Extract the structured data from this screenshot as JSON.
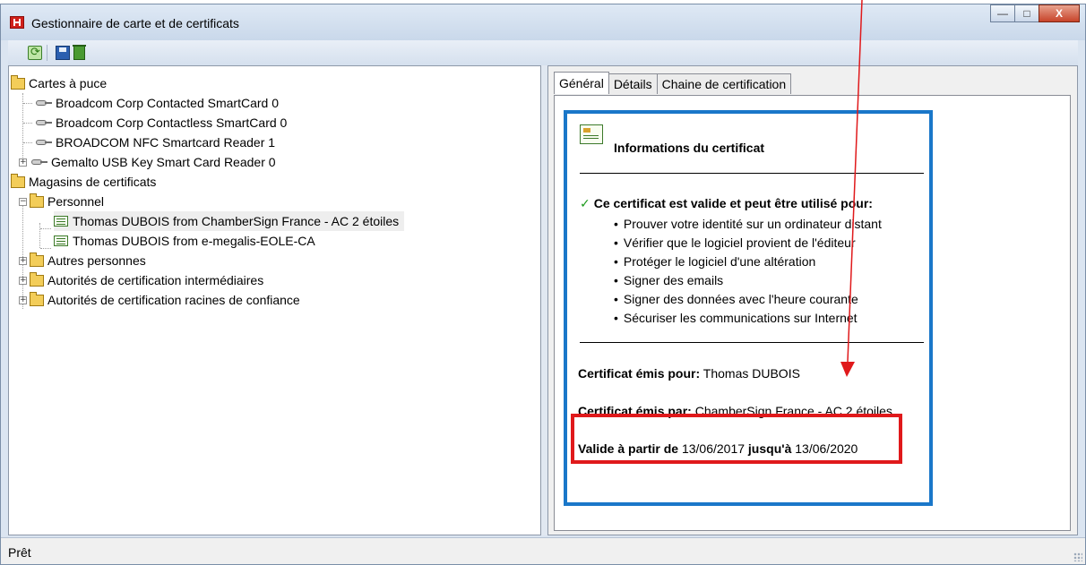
{
  "window": {
    "title": "Gestionnaire de carte et de certificats",
    "minimize_symbol": "—",
    "maximize_symbol": "□",
    "close_symbol": "X"
  },
  "tree": {
    "smartcards_label": "Cartes à puce",
    "readers": [
      "Broadcom Corp Contacted SmartCard 0",
      "Broadcom Corp Contactless SmartCard 0",
      "BROADCOM NFC Smartcard Reader 1",
      "Gemalto USB Key Smart Card Reader 0"
    ],
    "stores_label": "Magasins de certificats",
    "personal_label": "Personnel",
    "certificates": [
      "Thomas DUBOIS from ChamberSign France - AC 2 étoiles",
      "Thomas DUBOIS from e-megalis-EOLE-CA"
    ],
    "other_people_label": "Autres personnes",
    "intermediate_label": "Autorités de certification intermédiaires",
    "root_label": "Autorités de certification racines de confiance",
    "expand_symbol": "+",
    "collapse_symbol": "−"
  },
  "tabs": [
    "Général",
    "Détails",
    "Chaine de certification"
  ],
  "certificate": {
    "info_title": "Informations du certificat",
    "check_mark": "✓",
    "valid_heading": "Ce certificat est valide et peut être utilisé pour:",
    "purposes": [
      "Prouver votre identité sur un ordinateur distant",
      "Vérifier que le logiciel provient de l'éditeur",
      "Protéger le logiciel d'une altération",
      "Signer des emails",
      "Signer des données avec l'heure courante",
      "Sécuriser les communications sur Internet"
    ],
    "issued_to_label": "Certificat émis pour:",
    "issued_to_value": "Thomas DUBOIS",
    "issued_by_label": "Certificat émis par:",
    "issued_by_value": "ChamberSign France - AC 2 étoiles",
    "valid_from_label": "Valide à partir de",
    "valid_from_value": "13/06/2017",
    "valid_to_label": "jusqu'à",
    "valid_to_value": "13/06/2020"
  },
  "status": {
    "text": "Prêt"
  },
  "colors": {
    "panel_border": "#1a77c9",
    "highlight_box": "#e0191b",
    "annotation_arrow": "#e0191b",
    "valid_check": "#1a9a1a"
  }
}
